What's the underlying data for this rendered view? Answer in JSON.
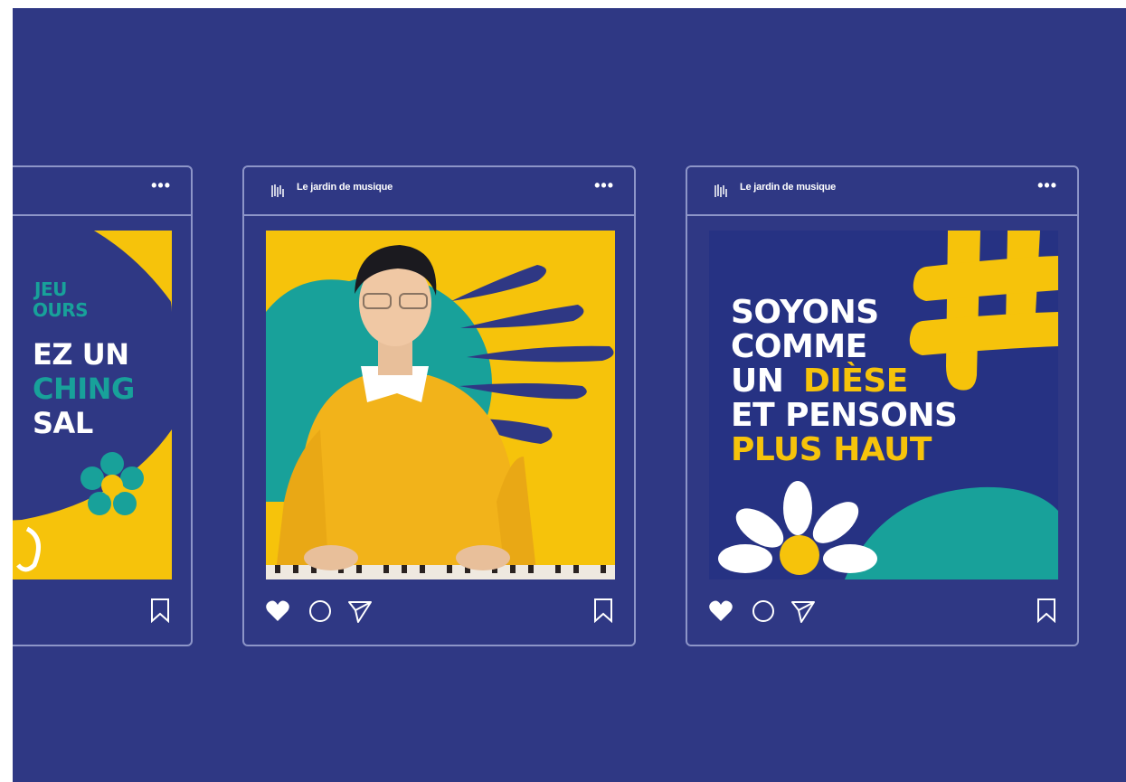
{
  "account_name": "Le jardin de musique",
  "more_glyph": "•••",
  "colors": {
    "background": "#2f3884",
    "yellow": "#f6c30b",
    "teal": "#18a19a",
    "white": "#ffffff",
    "border": "#8d95c8"
  },
  "posts": [
    {
      "id": "left",
      "lines": [
        "JEU",
        "OURS",
        "EZ UN",
        "CHING",
        "SAL"
      ]
    },
    {
      "id": "center",
      "image": "man-in-yellow-sweater-playing-piano"
    },
    {
      "id": "right",
      "lines": [
        "SOYONS",
        "COMME",
        "UN",
        "DIÈSE",
        "ET PENSONS",
        "PLUS HAUT"
      ]
    }
  ],
  "actions": {
    "like": "heart-icon",
    "comment": "comment-icon",
    "share": "send-icon",
    "save": "bookmark-icon"
  }
}
